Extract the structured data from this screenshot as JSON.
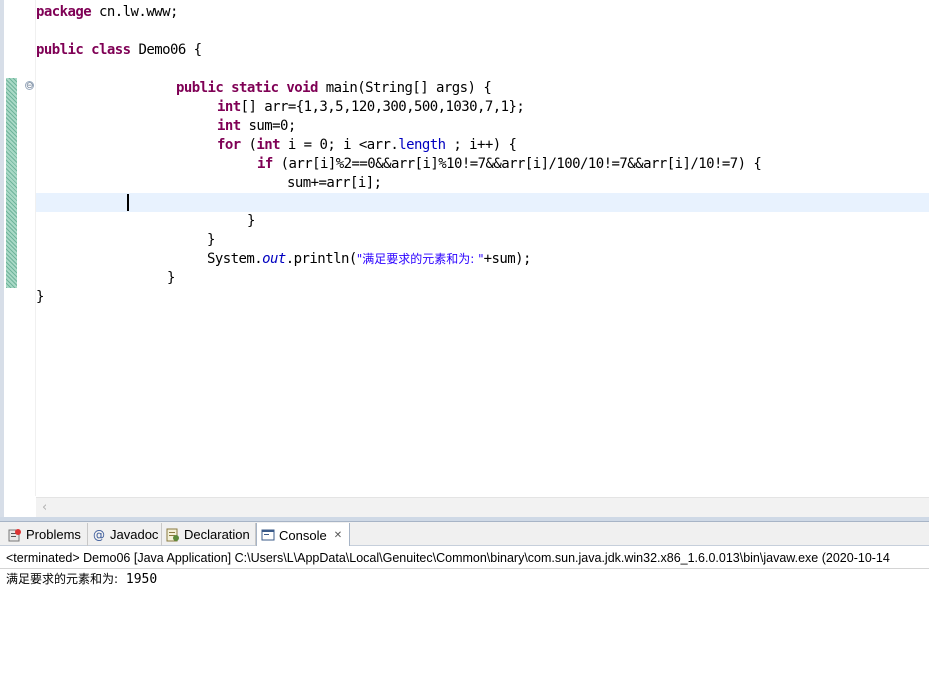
{
  "editor": {
    "lines": [
      [
        "package",
        " cn.lw.www;"
      ],
      [
        "public",
        " ",
        "class",
        " Demo06 {"
      ],
      [
        "public",
        " ",
        "static",
        " ",
        "void",
        " main(String[] args) {"
      ],
      [
        "int",
        "[] arr={1,3,5,120,300,500,1030,7,1};"
      ],
      [
        "int",
        " sum=0;"
      ],
      [
        "for",
        " (",
        "int",
        " i = 0; i <arr.",
        "length",
        " ; i++) {"
      ],
      [
        "if",
        " (arr[i]%2==0&&arr[i]%10!=7&&arr[i]/100/10!=7&&arr[i]/10!=7) {"
      ],
      [
        "sum+=arr[i];"
      ],
      [
        "}"
      ],
      [
        "}"
      ],
      [
        "System.",
        "out",
        ".println(",
        "\"满足要求的元素和为: \"",
        "+sum);"
      ],
      [
        "}"
      ],
      [
        "}"
      ]
    ],
    "fold_icon": "⊖"
  },
  "views": {
    "tabs": [
      {
        "label": "Problems",
        "icon": "problems-icon"
      },
      {
        "label": "Javadoc",
        "icon": "javadoc-icon"
      },
      {
        "label": "Declaration",
        "icon": "declaration-icon"
      },
      {
        "label": "Console",
        "icon": "console-icon",
        "close": "✕"
      }
    ]
  },
  "console": {
    "terminated": "<terminated> Demo06 [Java Application] C:\\Users\\L\\AppData\\Local\\Genuitec\\Common\\binary\\com.sun.java.jdk.win32.x86_1.6.0.013\\bin\\javaw.exe (2020-10-14",
    "output_label": "满足要求的元素和为:",
    "output_value": " 1950"
  },
  "colors": {
    "keyword": "#7f0055",
    "field": "#0000c0",
    "string": "#2a00ff",
    "current_line": "#e8f2fe"
  }
}
